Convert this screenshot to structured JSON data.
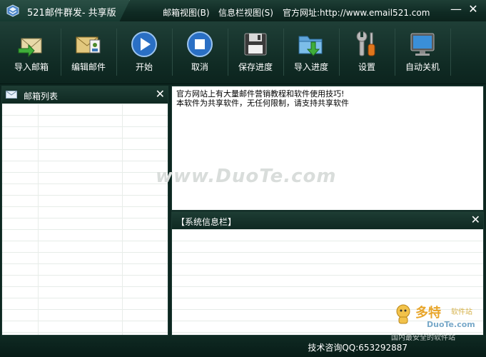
{
  "window": {
    "title": "521邮件群发- 共享版",
    "minimize_glyph": "—",
    "close_glyph": "✕"
  },
  "menu": [
    {
      "label": "邮箱视图(B)"
    },
    {
      "label": "信息栏视图(S)"
    },
    {
      "label": "官方网址:http://www.email521.com"
    }
  ],
  "toolbar": [
    {
      "label": "导入邮箱",
      "icon": "import-mailbox-icon"
    },
    {
      "label": "编辑邮件",
      "icon": "edit-mail-icon"
    },
    {
      "label": "开始",
      "icon": "play-icon"
    },
    {
      "label": "取消",
      "icon": "stop-icon"
    },
    {
      "label": "保存进度",
      "icon": "floppy-disk-icon"
    },
    {
      "label": "导入进度",
      "icon": "folder-import-icon"
    },
    {
      "label": "设置",
      "icon": "wrench-screwdriver-icon"
    },
    {
      "label": "自动关机",
      "icon": "monitor-icon"
    }
  ],
  "mailbox_panel": {
    "title": "邮箱列表",
    "close_glyph": "✕"
  },
  "notice": {
    "lines": [
      "官方网站上有大量邮件营销教程和软件使用技巧!",
      "本软件为共享软件，无任何限制，请支持共享软件"
    ]
  },
  "watermark": "www.DuoTe.com",
  "system_panel": {
    "title": "【系统信息栏】",
    "close_glyph": "✕"
  },
  "status": {
    "text": "技术咨询QQ:653292887"
  },
  "badge": {
    "main": "多特",
    "sub": "软件站",
    "domain": "DuoTe.com",
    "slogan": "国内最安全的软件站"
  },
  "colors": {
    "chrome": "#0f2a23",
    "accent_blue": "#2a6fc4",
    "badge_orange": "#e8a52a"
  }
}
